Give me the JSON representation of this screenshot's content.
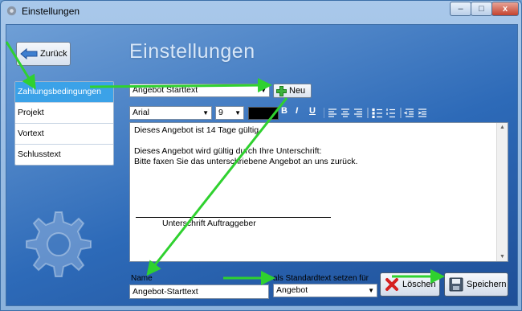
{
  "window": {
    "title": "Einstellungen",
    "minimize_glyph": "–",
    "maximize_glyph": "□",
    "close_glyph": "x"
  },
  "back_button": {
    "label": "Zurück",
    "icon": "arrow-left-icon"
  },
  "page_heading": "Einstellungen",
  "nav": {
    "items": [
      {
        "label": "Zahlungsbedingungen",
        "active": true
      },
      {
        "label": "Projekt",
        "active": false
      },
      {
        "label": "Vortext",
        "active": false
      },
      {
        "label": "Schlusstext",
        "active": false
      }
    ]
  },
  "template_select": {
    "value": "Angebot Starttext"
  },
  "new_button": {
    "label": "Neu",
    "icon": "plus-icon"
  },
  "toolbar": {
    "font": "Arial",
    "size": "9",
    "color": "#000000",
    "bold": "B",
    "italic": "I",
    "underline": "U"
  },
  "editor": {
    "lines": [
      "Dieses Angebot ist 14 Tage gültig",
      "",
      "Dieses Angebot wird gültig durch Ihre Unterschrift:",
      "Bitte faxen Sie das unterschriebene Angebot an uns zurück."
    ],
    "signature_label": "Unterschrift Auftraggeber"
  },
  "name_field": {
    "label": "Name",
    "value": "Angebot-Starttext"
  },
  "default_field": {
    "label": "als Standardtext setzen für",
    "value": "Angebot"
  },
  "delete_button": {
    "label": "Löschen",
    "icon": "delete-x-icon"
  },
  "save_button": {
    "label": "Speichern",
    "icon": "floppy-disk-icon"
  },
  "colors": {
    "accent": "#3ba2e8",
    "annotation_arrow": "#2fd12f",
    "background_blue": "#2d6ab8"
  }
}
